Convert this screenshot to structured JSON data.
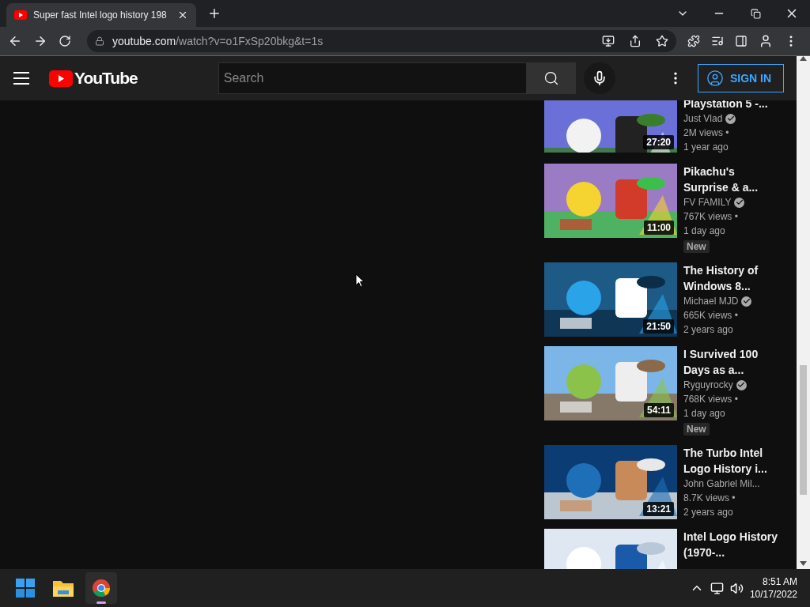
{
  "browser": {
    "tab": {
      "title": "Super fast Intel logo history 198",
      "selected": true
    },
    "address": {
      "host": "youtube.com",
      "path": "/watch?v=o1FxSp20bkg&t=1s"
    }
  },
  "header": {
    "logo": "YouTube",
    "search": {
      "placeholder": "Search"
    },
    "sign_in": "SIGN IN"
  },
  "videos": [
    {
      "title": "Playstation 5 -...",
      "channel": "Just Vlad",
      "verified": true,
      "views": "2M views •",
      "age": "1 year ago",
      "duration": "27:20"
    },
    {
      "title": "Pikachu's Surprise & a...",
      "channel": "FV FAMILY",
      "verified": true,
      "views": "767K views •",
      "age": "1 day ago",
      "badge": "New",
      "duration": "11:00"
    },
    {
      "title": "The History of Windows 8...",
      "channel": "Michael MJD",
      "verified": true,
      "views": "665K views •",
      "age": "2 years ago",
      "duration": "21:50"
    },
    {
      "title": "I Survived 100 Days as a...",
      "channel": "Ryguyrocky",
      "verified": true,
      "views": "768K views •",
      "age": "1 day ago",
      "badge": "New",
      "duration": "54:11"
    },
    {
      "title": "The Turbo Intel Logo History i...",
      "channel": "John Gabriel Mil...",
      "verified": false,
      "views": "8.7K views •",
      "age": "2 years ago",
      "duration": "13:21"
    },
    {
      "title": "Intel Logo History (1970-..."
    }
  ],
  "taskbar": {
    "time": "8:51 AM",
    "date": "10/17/2022"
  }
}
